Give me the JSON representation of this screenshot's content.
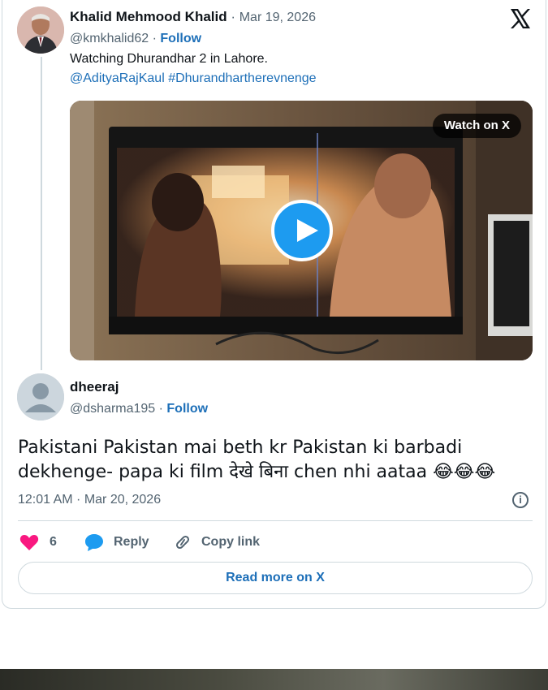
{
  "tweet": {
    "author_name": "Khalid Mehmood Khalid",
    "separator": " · ",
    "date": "Mar 19, 2026",
    "handle": "@kmkhalid62",
    "follow": "Follow",
    "text": "Watching Dhurandhar 2 in Lahore.",
    "mention": "@AdityaRajKaul",
    "hashtag": "#Dhurandhartherevnenge",
    "watch_on_x": "Watch on X"
  },
  "reply": {
    "author_name": "dheeraj",
    "handle": "@dsharma195",
    "follow": "Follow",
    "text": "Pakistani Pakistan mai beth kr Pakistan ki barbadi dekhenge- papa ki film देखे बिना chen nhi aataa 😂😂😂",
    "timestamp": "12:01 AM · Mar 20, 2026"
  },
  "actions": {
    "like_count": "6",
    "reply_label": "Reply",
    "copy_link_label": "Copy link",
    "read_more_label": "Read more on X"
  },
  "icons": {
    "brand": "x-logo-icon",
    "play": "play-icon",
    "heart": "heart-icon",
    "reply": "reply-bubble-icon",
    "link": "link-icon",
    "info": "info-icon"
  },
  "colors": {
    "link_blue": "#1d6fb8",
    "play_blue": "#1d9bf0",
    "heart_pink": "#f91880",
    "muted": "#536471"
  }
}
